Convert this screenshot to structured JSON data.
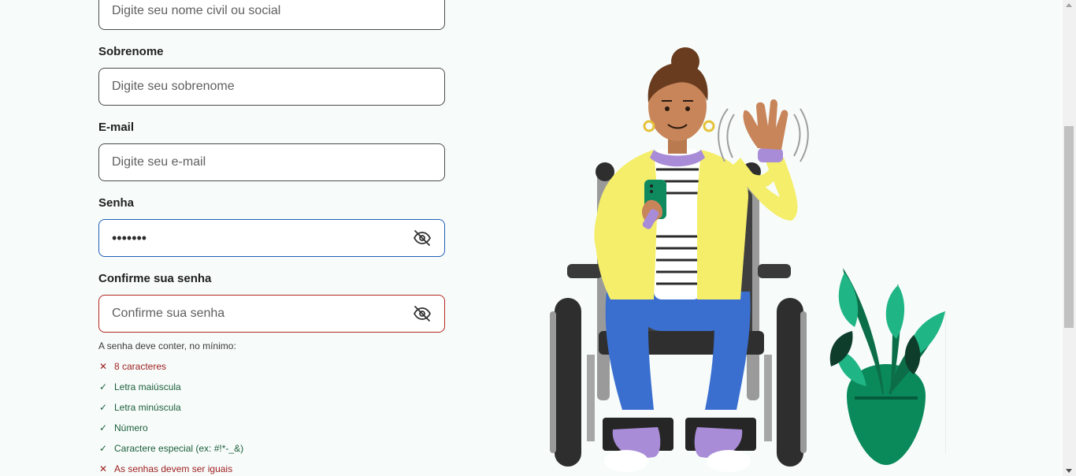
{
  "form": {
    "first_name": {
      "placeholder": "Digite seu nome civil ou social"
    },
    "last_name": {
      "label": "Sobrenome",
      "placeholder": "Digite seu sobrenome"
    },
    "email": {
      "label": "E-mail",
      "placeholder": "Digite seu e-mail"
    },
    "password": {
      "label": "Senha",
      "value": "•••••••"
    },
    "confirm_password": {
      "label": "Confirme sua senha",
      "placeholder": "Confirme sua senha"
    }
  },
  "rules": {
    "title": "A senha deve conter, no mínimo:",
    "items": [
      {
        "label": "8 caracteres",
        "status": "fail",
        "mark": "✕"
      },
      {
        "label": "Letra maiúscula",
        "status": "ok",
        "mark": "✓"
      },
      {
        "label": "Letra minúscula",
        "status": "ok",
        "mark": "✓"
      },
      {
        "label": "Número",
        "status": "ok",
        "mark": "✓"
      },
      {
        "label": "Caractere especial (ex: #!*-_&)",
        "status": "ok",
        "mark": "✓"
      },
      {
        "label": "As senhas devem ser iguais",
        "status": "fail",
        "mark": "✕"
      }
    ]
  },
  "icons": {
    "password_toggle": "eye-off-icon",
    "confirm_toggle": "eye-off-icon"
  },
  "colors": {
    "background": "#f7fcfb",
    "focus_border": "#1f5fb8",
    "error_border": "#b3261e",
    "fail_text": "#9e1c1c",
    "ok_text": "#1e5e3a"
  }
}
